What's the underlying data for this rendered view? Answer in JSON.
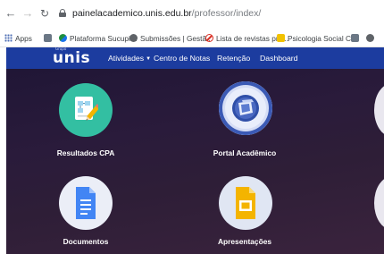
{
  "browser": {
    "url_host": "painelacademico.unis.edu.br",
    "url_path": "/professor/index/",
    "bookmarks": [
      {
        "label": "Apps",
        "icon": "apps-grid-icon"
      },
      {
        "label": "",
        "icon": "bookmark-favicon-icon"
      },
      {
        "label": "Plataforma Sucupira",
        "icon": "sucupira-favicon-icon"
      },
      {
        "label": "Submissões | Gestã...",
        "icon": "submissoes-favicon-icon"
      },
      {
        "label": "Lista de revistas pre...",
        "icon": "blocked-favicon-icon"
      },
      {
        "label": "Psicologia Social C...",
        "icon": "psicologia-favicon-icon"
      }
    ]
  },
  "navbar": {
    "logo": "unis",
    "logo_mark": "Grupo",
    "menu": [
      {
        "label": "Atividades",
        "has_dropdown": true
      },
      {
        "label": "Centro de Notas",
        "has_dropdown": false
      },
      {
        "label": "Retenção",
        "has_dropdown": false
      },
      {
        "label": "Dashboard",
        "has_dropdown": false
      }
    ],
    "background": "#1c3c9f"
  },
  "tiles": [
    {
      "label": "Resultados CPA",
      "icon": "cpa-results-icon",
      "color": "#33bfa2"
    },
    {
      "label": "Portal Acadêmico",
      "icon": "portal-academico-icon",
      "color": "#3b5ab5"
    },
    {
      "label": "Documentos",
      "icon": "google-docs-icon",
      "color": "#4285f4"
    },
    {
      "label": "Apresentações",
      "icon": "google-slides-icon",
      "color": "#f4b400"
    }
  ]
}
